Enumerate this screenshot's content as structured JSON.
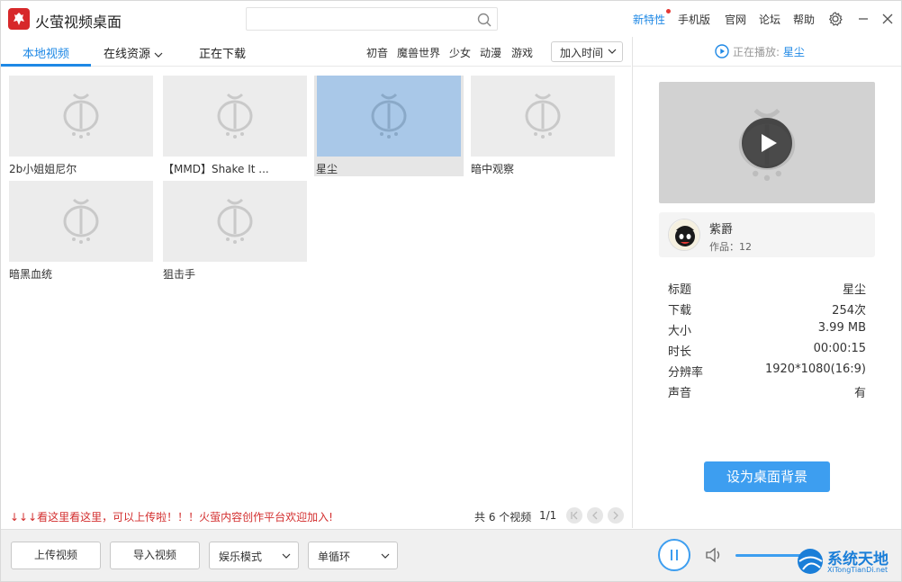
{
  "app": {
    "title": "火萤视频桌面"
  },
  "search": {
    "placeholder": "",
    "value": ""
  },
  "top_links": [
    "新特性",
    "手机版",
    "官网",
    "论坛",
    "帮助"
  ],
  "tabs": [
    {
      "label": "本地视频",
      "active": true
    },
    {
      "label": "在线资源",
      "has_dropdown": true
    },
    {
      "label": "正在下载"
    }
  ],
  "tags": [
    "初音",
    "魔兽世界",
    "少女",
    "动漫",
    "游戏"
  ],
  "sort": {
    "selected": "加入时间"
  },
  "now_playing": {
    "prefix": "正在播放:",
    "title": "星尘"
  },
  "videos": [
    {
      "title": "2b小姐姐尼尔",
      "selected": false
    },
    {
      "title": "【MMD】Shake It ...",
      "selected": false
    },
    {
      "title": "星尘",
      "selected": true
    },
    {
      "title": "暗中观察",
      "selected": false
    },
    {
      "title": "暗黑血统",
      "selected": false
    },
    {
      "title": "狙击手",
      "selected": false
    }
  ],
  "notice": "↓↓↓看这里看这里，可以上传啦！！！火萤内容创作平台欢迎加入!",
  "pager": {
    "summary": "共 6 个视频",
    "page": "1/1"
  },
  "author": {
    "name": "紫爵",
    "works": "作品：12"
  },
  "info": [
    {
      "key": "标题",
      "value": "星尘"
    },
    {
      "key": "下载",
      "value": "254次"
    },
    {
      "key": "大小",
      "value": "3.99 MB"
    },
    {
      "key": "时长",
      "value": "00:00:15"
    },
    {
      "key": "分辨率",
      "value": "1920*1080(16:9)"
    },
    {
      "key": "声音",
      "value": "有"
    }
  ],
  "set_bg_label": "设为桌面背景",
  "bottom": {
    "upload_label": "上传视频",
    "import_label": "导入视频",
    "mode": "娱乐模式",
    "loop": "单循环"
  },
  "watermark": {
    "text": "系统天地",
    "url": "XiTongTianDi.net"
  },
  "colors": {
    "accent": "#1e88e5",
    "button": "#3d9ef0",
    "notice": "#d32f2f",
    "logo": "#d7282a"
  }
}
